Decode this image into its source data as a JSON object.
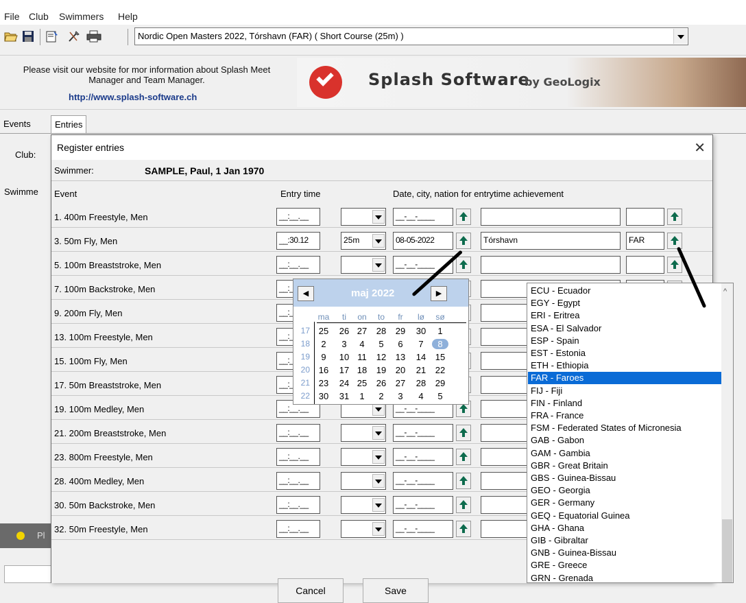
{
  "menu": [
    "File",
    "Club",
    "Swimmers",
    "Help"
  ],
  "toolbar": {
    "meet": "Nordic Open Masters 2022,  Tórshavn  (FAR)   ( Short Course (25m) )"
  },
  "info": {
    "text": "Please visit our website for mor information about Splash Meet Manager and Team Manager.",
    "link": "http://www.splash-software.ch",
    "logo_name": "Splash Software",
    "logo_by": "by GeoLogix"
  },
  "tabs": [
    "Events",
    "Entries"
  ],
  "side": {
    "club": "Club:",
    "swimmers": "Swimme"
  },
  "status": {
    "text": "Pl"
  },
  "dialog": {
    "title": "Register entries",
    "close": "✕",
    "swimmer_label": "Swimmer:",
    "swimmer_value": "SAMPLE, Paul, 1 Jan 1970",
    "header_event": "Event",
    "header_entry": "Entry time",
    "header_achievement": "Date, city, nation for entrytime achievement",
    "blank_time": "__:__.__",
    "blank_date": "__-__-____",
    "cancel": "Cancel",
    "save": "Save",
    "events": [
      "1. 400m Freestyle, Men",
      "3. 50m Fly, Men",
      "5. 100m Breaststroke, Men",
      "7. 100m Backstroke, Men",
      "9. 200m Fly, Men",
      "13. 100m Freestyle, Men",
      "15. 100m Fly, Men",
      "17. 50m Breaststroke, Men",
      "19. 100m Medley, Men",
      "21. 200m Breaststroke, Men",
      "23. 800m Freestyle, Men",
      "28. 400m Medley, Men",
      "30. 50m Backstroke, Men",
      "32. 50m Freestyle, Men"
    ],
    "row2": {
      "time": "__:30.12",
      "course": "25m",
      "date": "08-05-2022",
      "city": "Tórshavn",
      "nation": "FAR"
    }
  },
  "calendar": {
    "month": "maj 2022",
    "prev": "◀",
    "next": "▶",
    "dow": [
      "ma",
      "ti",
      "on",
      "to",
      "fr",
      "lø",
      "sø"
    ],
    "weeks": [
      "17",
      "18",
      "19",
      "20",
      "21",
      "22"
    ],
    "rows": [
      [
        "25",
        "26",
        "27",
        "28",
        "29",
        "30",
        "1"
      ],
      [
        "2",
        "3",
        "4",
        "5",
        "6",
        "7",
        "8"
      ],
      [
        "9",
        "10",
        "11",
        "12",
        "13",
        "14",
        "15"
      ],
      [
        "16",
        "17",
        "18",
        "19",
        "20",
        "21",
        "22"
      ],
      [
        "23",
        "24",
        "25",
        "26",
        "27",
        "28",
        "29"
      ],
      [
        "30",
        "31",
        "1",
        "2",
        "3",
        "4",
        "5"
      ]
    ],
    "selected_day": "8"
  },
  "nations": {
    "items": [
      "ECU - Ecuador",
      "EGY - Egypt",
      "ERI - Eritrea",
      "ESA - El Salvador",
      "ESP - Spain",
      "EST - Estonia",
      "ETH - Ethiopia",
      "FAR - Faroes",
      "FIJ - Fiji",
      "FIN - Finland",
      "FRA - France",
      "FSM - Federated States of Micronesia",
      "GAB - Gabon",
      "GAM - Gambia",
      "GBR - Great Britain",
      "GBS - Guinea-Bissau",
      "GEO - Georgia",
      "GER - Germany",
      "GEQ - Equatorial Guinea",
      "GHA - Ghana",
      "GIB - Gibraltar",
      "GNB - Guinea-Bissau",
      "GRE - Greece",
      "GRN - Grenada"
    ],
    "selected": "FAR - Faroes",
    "scroll_up": "^"
  },
  "colors": {
    "selection": "#0a6bd6",
    "calendar_header": "#bdd2ec",
    "up_arrow": "#0d6b4d"
  }
}
